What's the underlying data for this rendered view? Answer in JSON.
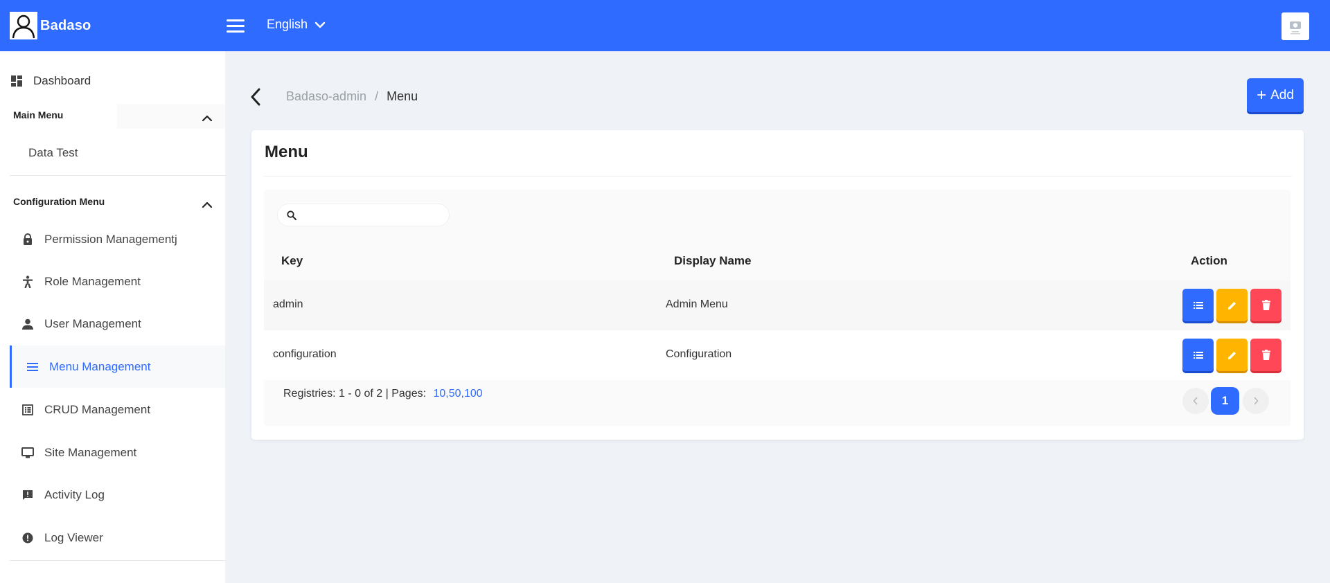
{
  "header": {
    "brand": "Badaso",
    "language": "English"
  },
  "sidebar": {
    "dashboard": "Dashboard",
    "main_menu": {
      "title": "Main Menu",
      "items": [
        "Data Test"
      ]
    },
    "config_menu": {
      "title": "Configuration Menu",
      "items": [
        {
          "label": "Permission Managementj",
          "icon": "lock-icon"
        },
        {
          "label": "Role Management",
          "icon": "accessibility-icon"
        },
        {
          "label": "User Management",
          "icon": "person-icon"
        },
        {
          "label": "Menu Management",
          "icon": "menu-lines-icon",
          "active": true
        },
        {
          "label": "CRUD Management",
          "icon": "list-alt-icon"
        },
        {
          "label": "Site Management",
          "icon": "monitor-icon"
        },
        {
          "label": "Activity Log",
          "icon": "feedback-icon"
        },
        {
          "label": "Log Viewer",
          "icon": "error-circle-icon"
        }
      ]
    }
  },
  "breadcrumb": {
    "parent": "Badaso-admin",
    "separator": "/",
    "current": "Menu"
  },
  "add_button": "Add",
  "card": {
    "title": "Menu",
    "search_placeholder": "",
    "columns": [
      "Key",
      "Display Name",
      "Action"
    ],
    "rows": [
      {
        "key": "admin",
        "display_name": "Admin Menu"
      },
      {
        "key": "configuration",
        "display_name": "Configuration"
      }
    ],
    "footer": {
      "summary": "Registries: 1 - 0 of 2 | Pages:",
      "page_sizes": [
        "10",
        ",50",
        ",100"
      ]
    },
    "pagination": {
      "current_page": "1"
    }
  },
  "colors": {
    "primary": "#2f6bff",
    "warning": "#ffb400",
    "danger": "#ff4757"
  }
}
